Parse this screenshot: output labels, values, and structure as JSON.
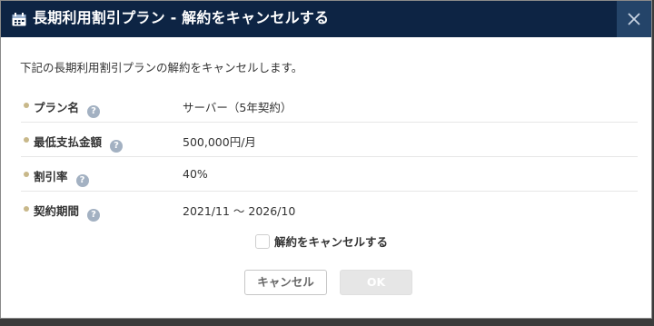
{
  "dialog": {
    "title": "長期利用割引プラン - 解約をキャンセルする",
    "title_icon": "calendar-icon",
    "close_icon": "close-icon",
    "intro": "下記の長期利用割引プランの解約をキャンセルします。",
    "help_glyph": "?",
    "fields": [
      {
        "label": "プラン名",
        "value": "サーバー（5年契約）"
      },
      {
        "label": "最低支払金額",
        "value": "500,000円/月"
      },
      {
        "label": "割引率",
        "value": "40%"
      },
      {
        "label": "契約期間",
        "value": "2021/11 ～ 2026/10"
      }
    ],
    "confirm_checkbox": {
      "label": "解約をキャンセルする",
      "checked": false
    },
    "buttons": {
      "cancel": "キャンセル",
      "ok": "OK",
      "ok_disabled": true
    }
  },
  "colors": {
    "titlebar": "#0d2444",
    "close_button": "#244469",
    "bullet": "#c8b88a",
    "help_icon": "#a3b1c2",
    "ok_disabled": "#e6e6e6"
  }
}
